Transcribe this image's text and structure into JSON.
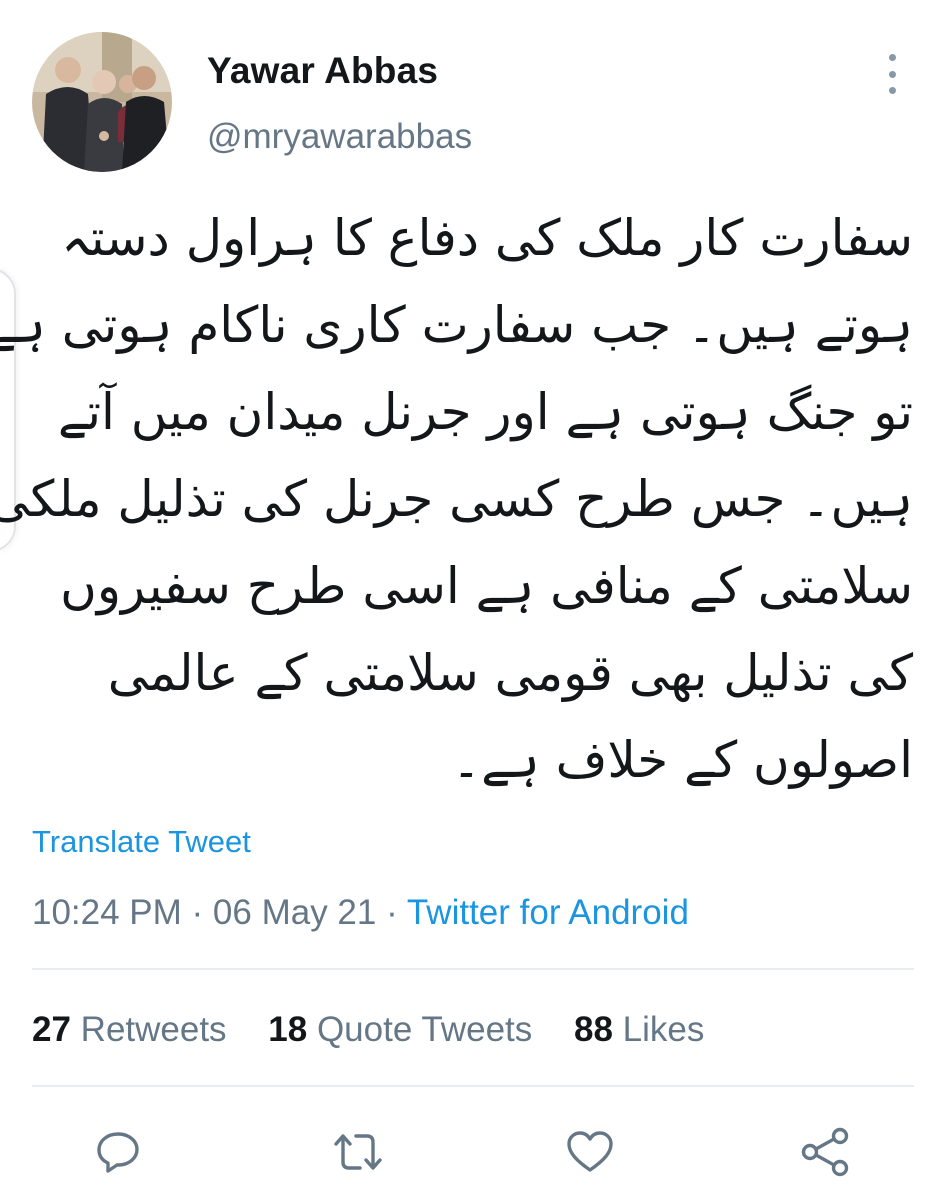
{
  "profile": {
    "display_name": "Yawar Abbas",
    "handle": "@mryawarabbas"
  },
  "tweet": {
    "direction": "rtl",
    "lines": [
      "سفارت کار ملک کی دفاع کا ہراول دستہ",
      "ہوتے ہیں۔ جب سفارت کاری ناکام ہوتی ہے",
      "تو جنگ ہوتی ہے اور جرنل میدان میں آتے",
      "ہیں۔ جس طرح کسی جرنل کی تذلیل ملکی",
      "سلامتی کے منافی ہے اسی طرح سفیروں",
      "کی تذلیل بھی قومی سلامتی کے عالمی",
      "اصولوں کے خلاف ہے۔"
    ],
    "translate_label": "Translate Tweet",
    "time": "10:24 PM",
    "separator": " · ",
    "date": "06 May 21",
    "source": "Twitter for Android"
  },
  "stats": {
    "retweets_count": "27",
    "retweets_label": " Retweets",
    "quotes_count": "18",
    "quotes_label": " Quote Tweets",
    "likes_count": "88",
    "likes_label": " Likes"
  },
  "actions": {
    "icons": [
      "reply-icon",
      "retweet-icon",
      "like-icon",
      "share-icon"
    ]
  },
  "colors": {
    "link": "#1b95e0",
    "secondary_text": "#657786",
    "primary_text": "#14171a",
    "divider": "#e6ecf0"
  }
}
